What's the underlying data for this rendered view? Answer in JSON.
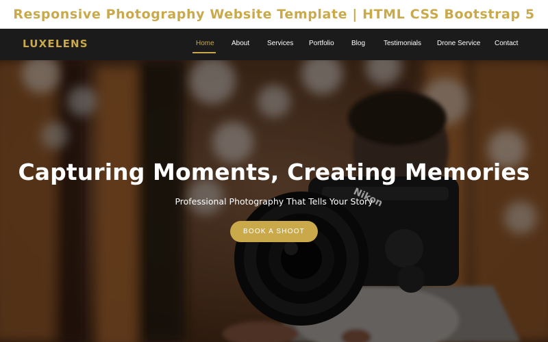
{
  "banner": {
    "title": "Responsive Photography Website Template | HTML CSS Bootstrap 5"
  },
  "navbar": {
    "brand": "LUXELENS",
    "links": [
      {
        "label": "Home",
        "active": true
      },
      {
        "label": "About"
      },
      {
        "label": "Services"
      },
      {
        "label": "Portfolio"
      },
      {
        "label": "Blog"
      },
      {
        "label": "Testimonials"
      },
      {
        "label": "Drone Service"
      },
      {
        "label": "Contact"
      }
    ]
  },
  "hero": {
    "title": "Capturing Moments, Creating Memories",
    "subtitle": "Professional Photography That Tells Your Story",
    "button": "BOOK A SHOOT"
  },
  "camera_brand_text": "Nikon",
  "colors": {
    "accent": "#c9a94a",
    "navbar_bg": "#1b1b1b",
    "text_light": "#ffffff"
  }
}
